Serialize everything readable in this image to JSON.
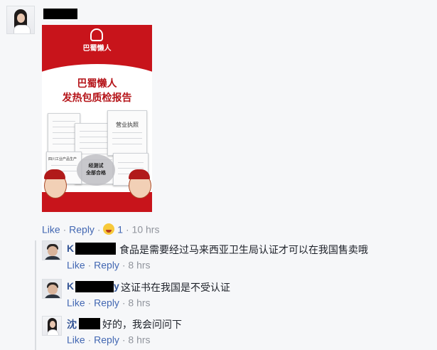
{
  "post": {
    "like_label": "Like",
    "reply_label": "Reply",
    "reaction_count": "1",
    "time": "10 hrs",
    "image": {
      "brand": "巴蜀懒人",
      "title_line1": "巴蜀懒人",
      "title_line2": "发热包质检报告",
      "stamp_line1": "经测试",
      "stamp_line2": "全部合格",
      "doc_title": "营业执照",
      "doc_left_title": "四川工业产品生产"
    }
  },
  "replies": [
    {
      "name_visible": "K",
      "text": "食品是需要经过马来西亚卫生局认证才可以在我国售卖哦",
      "like_label": "Like",
      "reply_label": "Reply",
      "time": "8 hrs"
    },
    {
      "name_visible": "K",
      "name_tail": "y",
      "text": "这证书在我国是不受认证",
      "like_label": "Like",
      "reply_label": "Reply",
      "time": "8 hrs"
    },
    {
      "name_visible": "沈",
      "text": "好的，我会问问下",
      "like_label": "Like",
      "reply_label": "Reply",
      "time": "8 hrs"
    }
  ],
  "separator": "·",
  "colors": {
    "link": "#4267b2",
    "meta": "#90949c",
    "brand_red": "#c8141b"
  }
}
